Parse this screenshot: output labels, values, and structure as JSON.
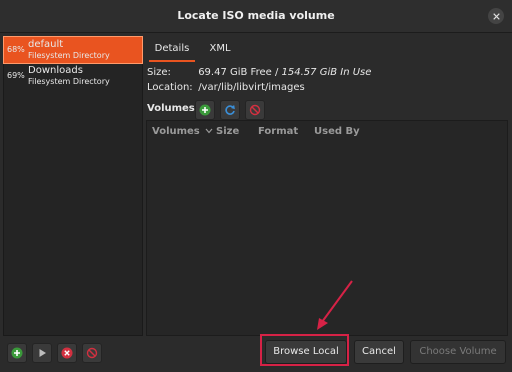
{
  "window": {
    "title": "Locate ISO media volume"
  },
  "pools": [
    {
      "percent": "68%",
      "name": "default",
      "type": "Filesystem Directory",
      "selected": true
    },
    {
      "percent": "69%",
      "name": "Downloads",
      "type": "Filesystem Directory",
      "selected": false
    }
  ],
  "tabs": [
    {
      "label": "Details",
      "active": true
    },
    {
      "label": "XML",
      "active": false
    }
  ],
  "details": {
    "size_label": "Size:",
    "size_free": "69.47 GiB Free /",
    "size_used": "154.57 GiB In Use",
    "location_label": "Location:",
    "location_value": "/var/lib/libvirt/images"
  },
  "volumes": {
    "label": "Volumes",
    "columns": [
      "Volumes",
      "Size",
      "Format",
      "Used By"
    ]
  },
  "buttons": {
    "browse_local": "Browse Local",
    "cancel": "Cancel",
    "choose_volume": "Choose Volume"
  },
  "colors": {
    "accent": "#e95420",
    "add": "#3a9a3a",
    "refresh": "#3a8fd8",
    "delete": "#d33040",
    "highlight": "#d62246"
  },
  "icons": {
    "volume_add": "plus-circle-icon",
    "volume_refresh": "refresh-icon",
    "volume_delete": "no-entry-icon",
    "pool_add": "plus-circle-icon",
    "pool_start": "play-icon",
    "pool_stop": "stop-x-icon",
    "pool_delete": "no-entry-icon"
  }
}
